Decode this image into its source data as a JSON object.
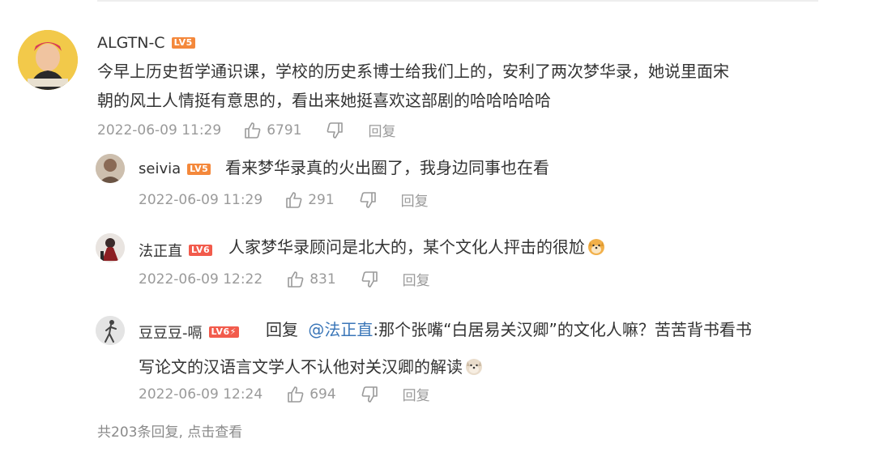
{
  "comments": [
    {
      "username": "ALGTN-C",
      "level": "LV5",
      "text_line1": "今早上历史哲学通识课，学校的历史系博士给我们上的，安利了两次梦华录，她说里面宋",
      "text_line2": "朝的风土人情挺有意思的，看出来她挺喜欢这部剧的哈哈哈哈哈",
      "timestamp": "2022-06-09 11:29",
      "likes": "6791",
      "reply_label": "回复"
    }
  ],
  "replies": [
    {
      "username": "seivia",
      "level": "LV5",
      "text": "看来梦华录真的火出圈了，我身边同事也在看",
      "timestamp": "2022-06-09 11:29",
      "likes": "291",
      "reply_label": "回复"
    },
    {
      "username": "法正直",
      "level": "LV6",
      "text": "人家梦华录顾问是北大的，某个文化人抨击的很尬",
      "emoji": "doge-emoji",
      "timestamp": "2022-06-09 12:22",
      "likes": "831",
      "reply_label": "回复"
    },
    {
      "username": "豆豆豆-嗝",
      "level": "LV6⚡",
      "reply_prefix": "回复",
      "mention": "@法正直",
      "text_line1": ":那个张嘴“白居易关汉卿”的文化人嘛？苦苦背书看书",
      "text_line2": "写论文的汉语言文学人不认他对关汉卿的解读",
      "emoji": "doge-emoji",
      "timestamp": "2022-06-09 12:24",
      "likes": "694",
      "reply_label": "回复"
    }
  ],
  "footer": {
    "text": "共203条回复, 点击查看"
  },
  "colors": {
    "badge_lv5": "#f4883b",
    "badge_lv6": "#f25b4c",
    "link": "#3a76b8",
    "meta": "#9a9a9a"
  }
}
